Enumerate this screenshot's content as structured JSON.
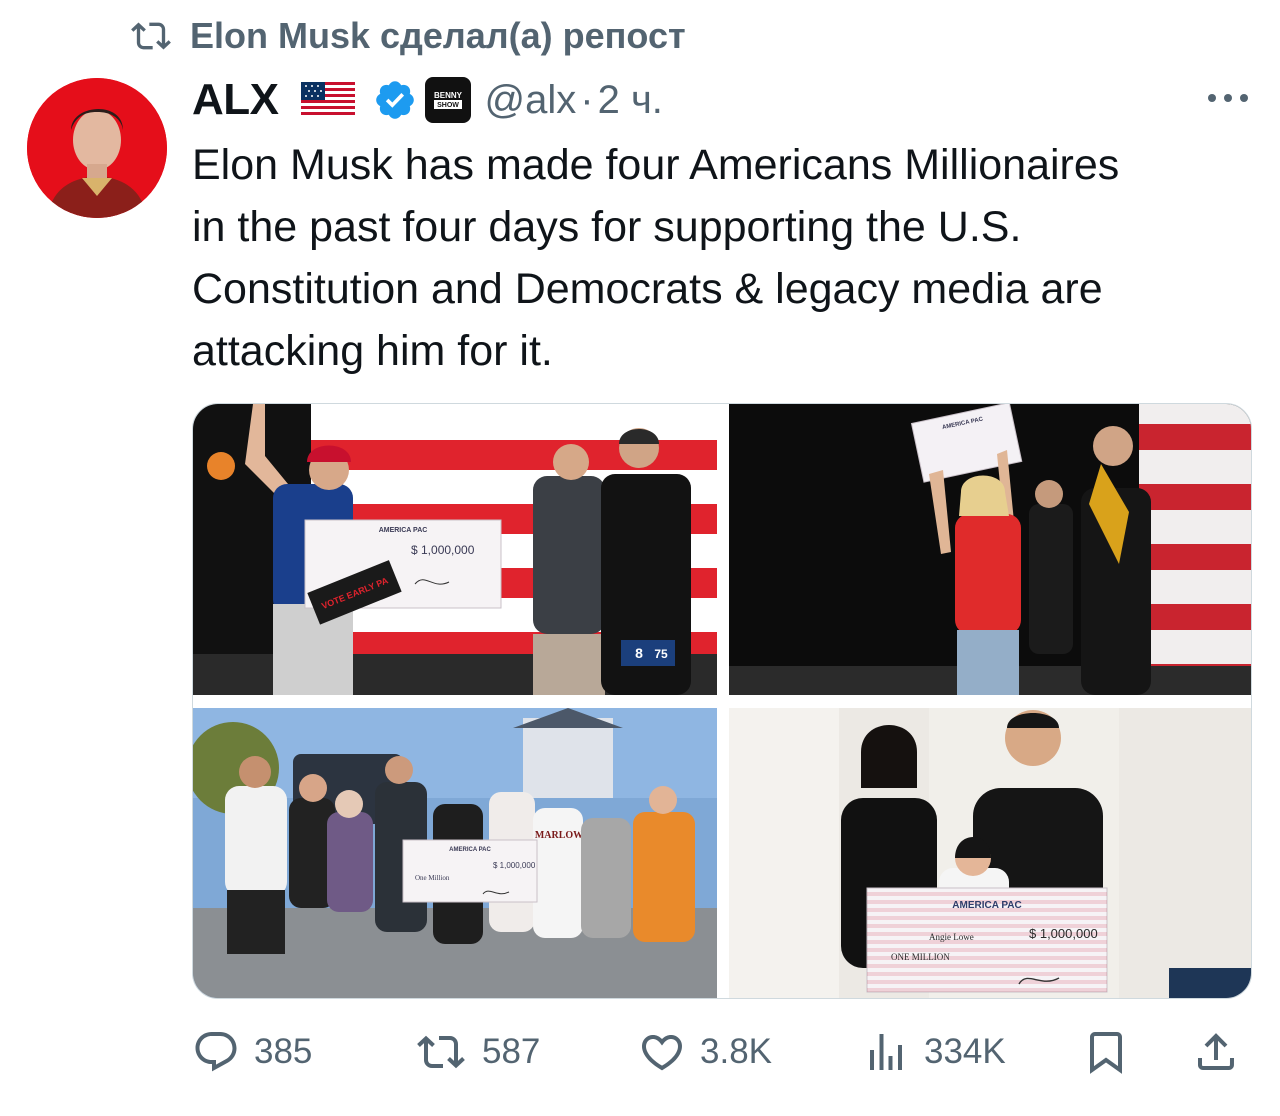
{
  "repost": {
    "text": "Elon Musk сделал(а) репост",
    "icon": "repost-icon"
  },
  "author": {
    "name": "ALX",
    "handle": "@alx",
    "separator": "·",
    "time": "2 ч.",
    "verified": true,
    "flag": "us-flag",
    "affiliation_badge": "BENNY SHOW"
  },
  "tweet": {
    "lines": [
      "Elon Musk has made four Americans Millionaires",
      "in the past four days for supporting the U.S.",
      "Constitution and Democrats & legacy media are",
      "attacking him for it."
    ]
  },
  "media": {
    "photos": [
      {
        "check_header": "AMERICA PAC",
        "amount": "$ 1,000,000",
        "sign": "VOTE EARLY PA",
        "station": "8",
        "station2": "75"
      },
      {
        "check_header": "AMERICA PAC"
      },
      {
        "check_header": "AMERICA PAC",
        "amount": "$ 1,000,000",
        "words": "One Million",
        "shirt": "MARLOW"
      },
      {
        "check_header": "AMERICA PAC",
        "amount": "$ 1,000,000",
        "words": "ONE MILLION",
        "payee": "Angie Lowe"
      }
    ]
  },
  "actions": {
    "replies": "385",
    "reposts": "587",
    "likes": "3.8K",
    "views": "334K"
  },
  "colors": {
    "secondary_text": "#536471",
    "verified_blue": "#1d9bf0",
    "text": "#0f1419"
  }
}
